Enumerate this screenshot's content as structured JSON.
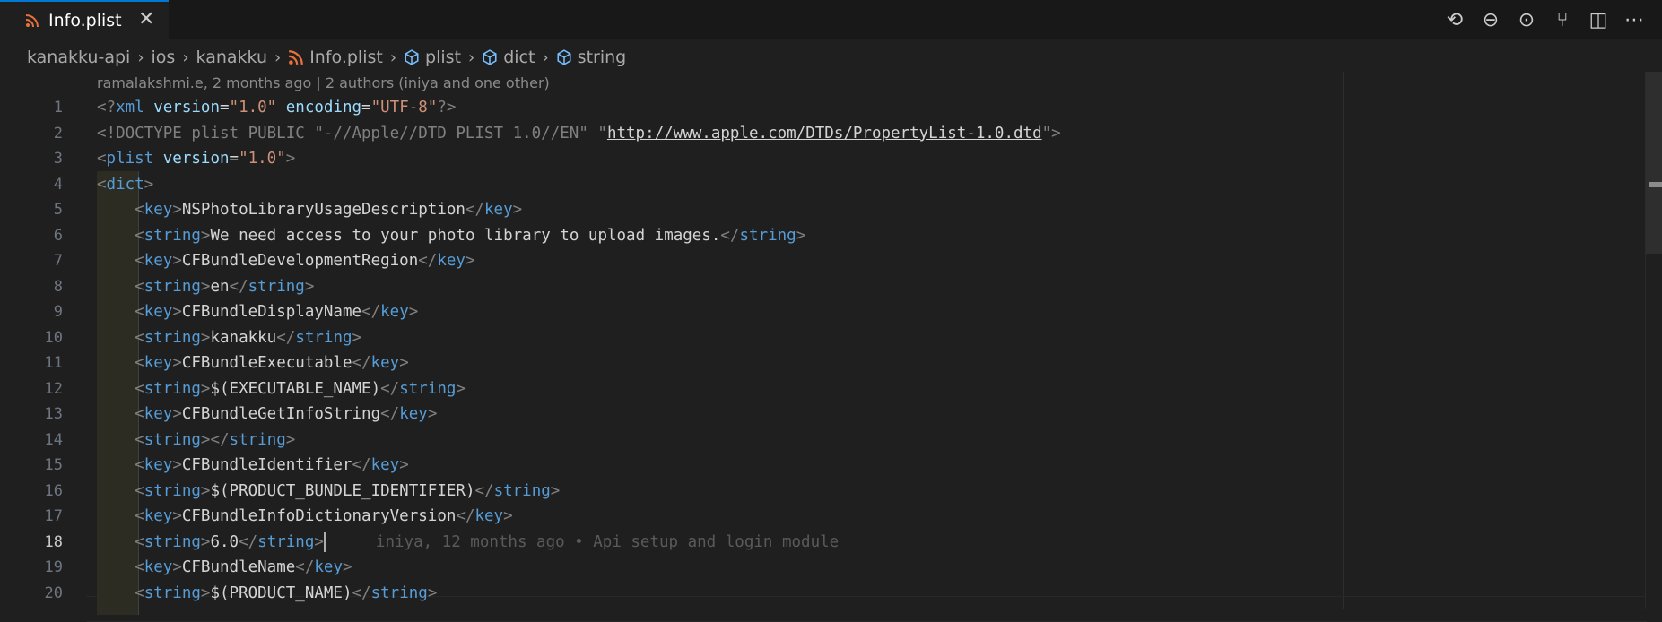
{
  "tab": {
    "icon": "rss-icon",
    "label": "Info.plist",
    "close": "✕"
  },
  "toolbar": [
    {
      "name": "open-changes-icon",
      "glyph": "⟲"
    },
    {
      "name": "previous-change-icon",
      "glyph": "⊖"
    },
    {
      "name": "next-change-icon",
      "glyph": "⊙"
    },
    {
      "name": "git-graph-icon",
      "glyph": "⑂"
    },
    {
      "name": "split-editor-icon",
      "glyph": "◫"
    },
    {
      "name": "more-actions-icon",
      "glyph": "⋯"
    }
  ],
  "breadcrumb": [
    "kanakku-api",
    "ios",
    "kanakku",
    "Info.plist",
    "plist",
    "dict",
    "string"
  ],
  "blame_header": "ramalakshmi.e, 2 months ago | 2 authors (iniya and one other)",
  "line_numbers": [
    "1",
    "2",
    "3",
    "4",
    "5",
    "6",
    "7",
    "8",
    "9",
    "10",
    "11",
    "12",
    "13",
    "14",
    "15",
    "16",
    "17",
    "18",
    "19",
    "20"
  ],
  "active_line": "18",
  "lines": {
    "l1": [
      "<?",
      "xml",
      " version",
      "=",
      "\"1.0\"",
      " encoding",
      "=",
      "\"UTF-8\"",
      "?>"
    ],
    "l2": [
      "<!DOCTYPE plist PUBLIC \"-//Apple//DTD PLIST 1.0//EN\" \"",
      "http://www.apple.com/DTDs/PropertyList-1.0.dtd",
      "\">"
    ],
    "l3": [
      "<",
      "plist",
      " version",
      "=",
      "\"1.0\"",
      ">"
    ],
    "l4": [
      "<",
      "dict",
      ">"
    ],
    "l5": [
      "<",
      "key",
      ">",
      "NSPhotoLibraryUsageDescription",
      "</",
      "key",
      ">"
    ],
    "l6": [
      "<",
      "string",
      ">",
      "We need access to your photo library to upload images.",
      "</",
      "string",
      ">"
    ],
    "l7": [
      "<",
      "key",
      ">",
      "CFBundleDevelopmentRegion",
      "</",
      "key",
      ">"
    ],
    "l8": [
      "<",
      "string",
      ">",
      "en",
      "</",
      "string",
      ">"
    ],
    "l9": [
      "<",
      "key",
      ">",
      "CFBundleDisplayName",
      "</",
      "key",
      ">"
    ],
    "l10": [
      "<",
      "string",
      ">",
      "kanakku",
      "</",
      "string",
      ">"
    ],
    "l11": [
      "<",
      "key",
      ">",
      "CFBundleExecutable",
      "</",
      "key",
      ">"
    ],
    "l12": [
      "<",
      "string",
      ">",
      "$(EXECUTABLE_NAME)",
      "</",
      "string",
      ">"
    ],
    "l13": [
      "<",
      "key",
      ">",
      "CFBundleGetInfoString",
      "</",
      "key",
      ">"
    ],
    "l14": [
      "<",
      "string",
      ">",
      "",
      "</",
      "string",
      ">"
    ],
    "l15": [
      "<",
      "key",
      ">",
      "CFBundleIdentifier",
      "</",
      "key",
      ">"
    ],
    "l16": [
      "<",
      "string",
      ">",
      "$(PRODUCT_BUNDLE_IDENTIFIER)",
      "</",
      "string",
      ">"
    ],
    "l17": [
      "<",
      "key",
      ">",
      "CFBundleInfoDictionaryVersion",
      "</",
      "key",
      ">"
    ],
    "l18": [
      "<",
      "string",
      ">",
      "6.0",
      "</",
      "string",
      ">"
    ],
    "l19": [
      "<",
      "key",
      ">",
      "CFBundleName",
      "</",
      "key",
      ">"
    ],
    "l20": [
      "<",
      "string",
      ">",
      "$(PRODUCT_NAME)",
      "</",
      "string",
      ">"
    ]
  },
  "inline_blame": "iniya, 12 months ago • Api setup and login module",
  "colors": {
    "accent": "#0078d4",
    "tag": "#569cd6",
    "attr": "#9cdcfe",
    "string": "#ce9178",
    "rss": "#e8713c",
    "symbol": "#75beff"
  }
}
